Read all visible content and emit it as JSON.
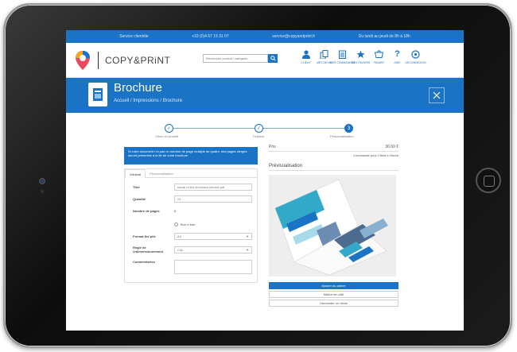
{
  "topbar": {
    "service": "Service clientèle",
    "phone": "+33 (0)4 67 15 31 07",
    "email": "service@copyandprint.fr",
    "hours": "Du lundi au jeudi de 8h à 18h"
  },
  "header": {
    "brand": "COPY&PRiNT",
    "search_placeholder": "Recherche produit / catégorie",
    "nav": [
      {
        "label": "CLIENT",
        "icon": "user-icon"
      },
      {
        "label": "MES DEVIS",
        "icon": "quotes-icon"
      },
      {
        "label": "MES COMMANDES",
        "icon": "orders-icon"
      },
      {
        "label": "MES FAVORIS",
        "icon": "star-icon"
      },
      {
        "label": "PANIER",
        "icon": "basket-icon"
      },
      {
        "label": "AIDE",
        "icon": "help-icon"
      },
      {
        "label": "DECONNEXION",
        "icon": "logout-icon"
      }
    ]
  },
  "banner": {
    "title": "Brochure",
    "breadcrumb": [
      "Accueil",
      "Impressions",
      "Brochure"
    ],
    "close_icon": "close-icon"
  },
  "steps": [
    {
      "label": "Choix du produit",
      "state": "done"
    },
    {
      "label": "Fichiers",
      "state": "done"
    },
    {
      "label": "Personnalisation",
      "state": "active",
      "number": "3"
    }
  ],
  "notice": "Si votre document n'a pas un nombre de page multiple de quatre, des pages vierges seront présentes à la fin de votre brochure",
  "form": {
    "tabs": [
      "Général",
      "Personnalisation"
    ],
    "titre_label": "Titre",
    "titre_value": "name-of-the-brochure-service.pdf",
    "quantite_label": "Quantité",
    "quantite_value": "24",
    "pages_label": "Nombre de pages",
    "pages_value": "8",
    "radio_label": "Bon à tirer",
    "format_label": "Format fini plié",
    "format_value": "A4",
    "regle_label": "Règle de redimensionnement",
    "regle_value": "Clip",
    "comment_label": "Commentaires"
  },
  "summary": {
    "prix_label": "Prix",
    "prix_value": "36.60 €",
    "subnote": "Commande pour Client e-Genre",
    "preview_heading": "Prévisualisation",
    "btn_cart": "Ajouter au panier",
    "btn_save": "Mettre de côté",
    "btn_quote": "Demander un devis"
  },
  "colors": {
    "accent": "#1a73c4",
    "teal": "#33a9c9",
    "device": "#151515"
  }
}
